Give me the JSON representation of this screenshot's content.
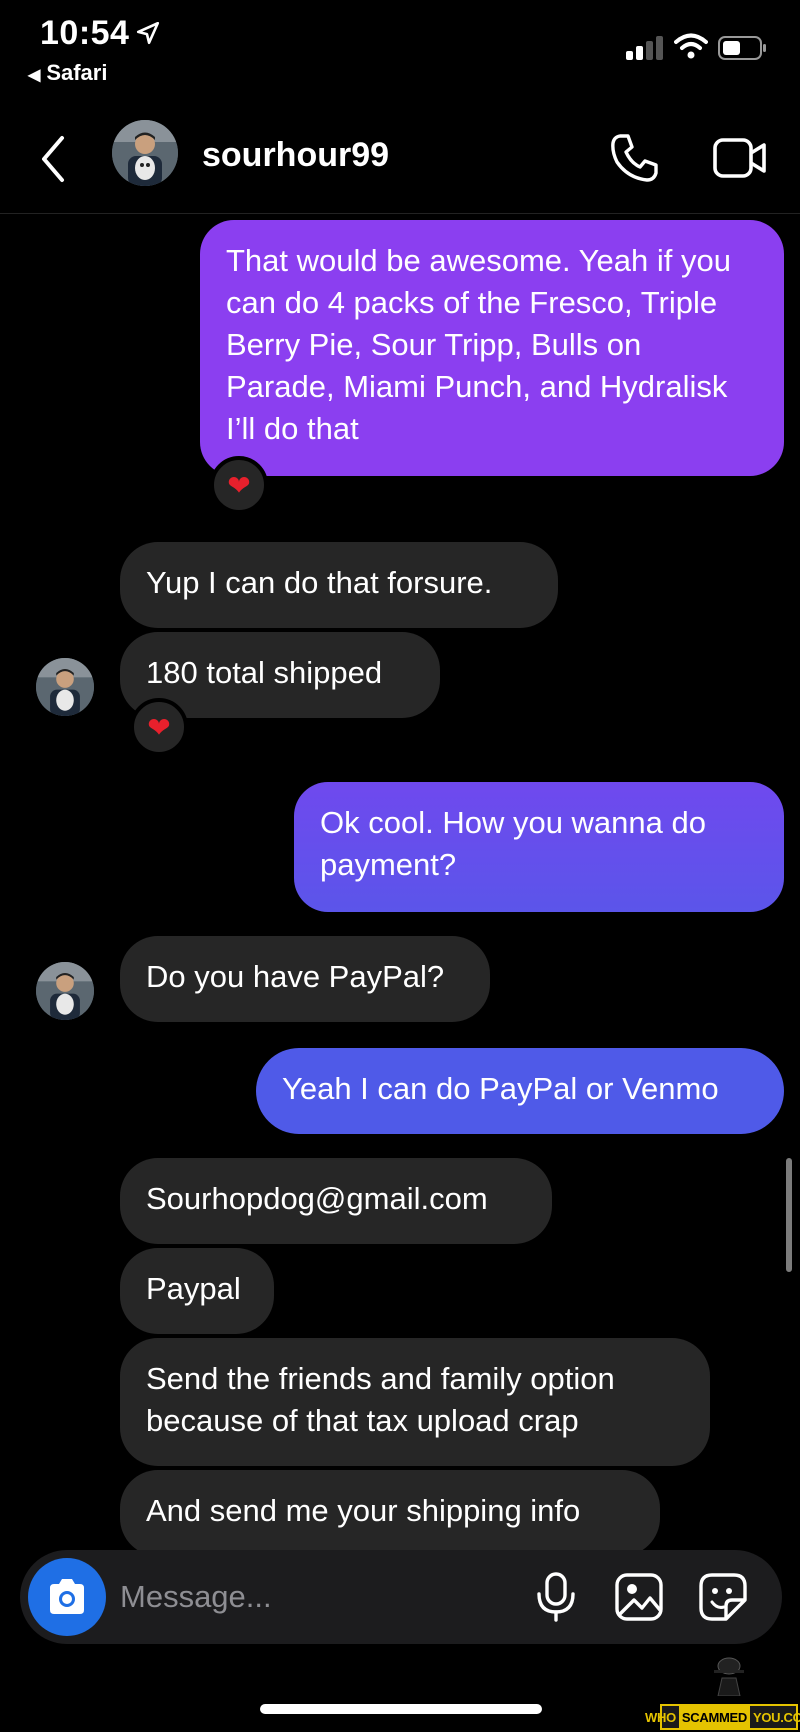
{
  "status_bar": {
    "time": "10:54",
    "back_app": "Safari",
    "back_app_arrow": "◀"
  },
  "header": {
    "username": "sourhour99",
    "icons": [
      "back-chevron-icon",
      "phone-icon",
      "video-camera-icon"
    ]
  },
  "messages": [
    {
      "from": "me",
      "text": "That would be awesome. Yeah if you can do 4 packs of the Fresco, Triple Berry Pie, Sour Tripp, Bulls on Parade, Miami Punch, and Hydralisk I’ll do that",
      "reaction": "❤"
    },
    {
      "from": "them",
      "text": "Yup I can do that forsure."
    },
    {
      "from": "them",
      "text": "180 total shipped",
      "reaction": "❤"
    },
    {
      "from": "me",
      "text": "Ok cool. How you wanna do payment?"
    },
    {
      "from": "them",
      "text": "Do you have PayPal?"
    },
    {
      "from": "me",
      "text": "Yeah I can do PayPal or Venmo"
    },
    {
      "from": "them",
      "text": "Sourhopdog@gmail.com"
    },
    {
      "from": "them",
      "text": "Paypal"
    },
    {
      "from": "them",
      "text": "Send the friends and family option because of that tax upload crap"
    },
    {
      "from": "them",
      "text": "And send me your shipping info"
    }
  ],
  "composer": {
    "placeholder": "Message...",
    "icons": [
      "camera-icon",
      "microphone-icon",
      "gallery-icon",
      "sticker-icon"
    ]
  },
  "watermark": {
    "who": "WHO",
    "scammed": "SCAMMED",
    "you": "YOU.COM"
  },
  "colors": {
    "background": "#000000",
    "incoming_bubble": "#262626",
    "outgoing_purple": "#8b3ff0",
    "outgoing_blue": "#4f5ae8",
    "camera_button": "#1f6fe5",
    "heart": "#e8202c"
  }
}
